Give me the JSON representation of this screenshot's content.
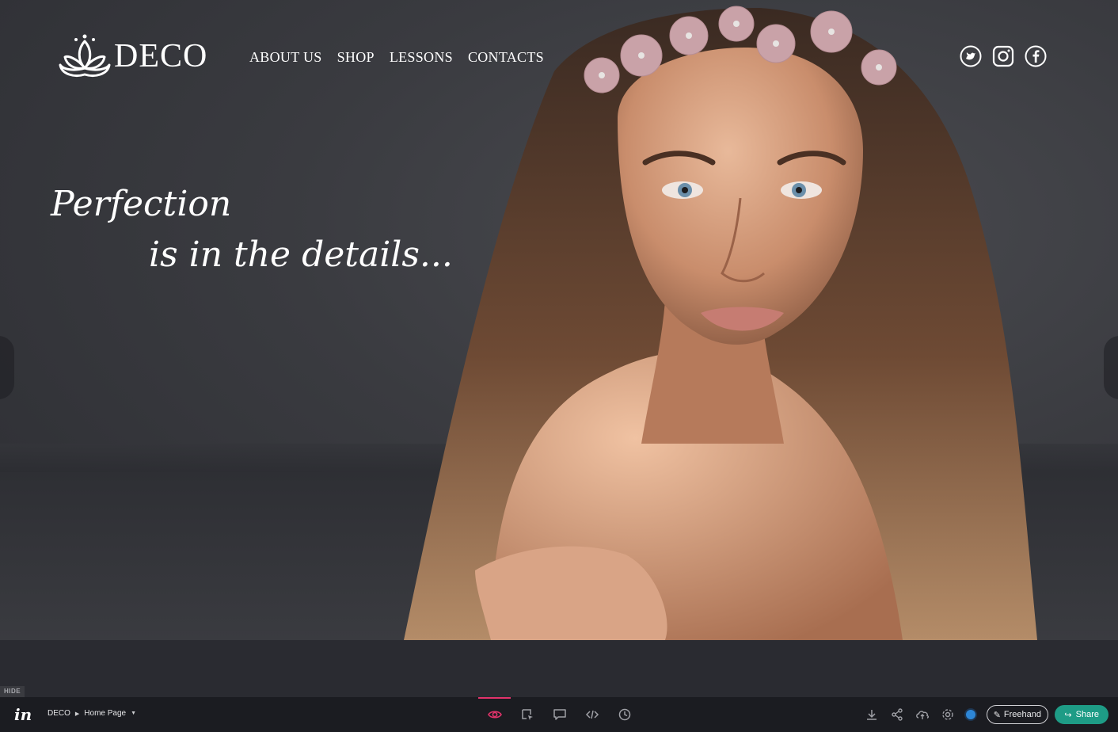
{
  "brand": {
    "name": "DECO"
  },
  "nav": {
    "items": [
      "ABOUT US",
      "SHOP",
      "LESSONS",
      "CONTACTS"
    ]
  },
  "social": {
    "icons": [
      "twitter-icon",
      "instagram-icon",
      "facebook-icon"
    ]
  },
  "hero": {
    "line1": "Perfection",
    "line2": "is in the details..."
  },
  "prototype_bar": {
    "hide_label": "HIDE",
    "logo": "in",
    "project": "DECO",
    "screen": "Home Page",
    "tools": [
      "preview-eye-icon",
      "inspect-icon",
      "comment-icon",
      "code-icon",
      "history-icon"
    ],
    "right_icons": [
      "download-icon",
      "share-nodes-icon",
      "cloud-sync-icon",
      "settings-icon"
    ],
    "freehand_label": "Freehand",
    "share_label": "Share"
  },
  "colors": {
    "accent": "#e2336b",
    "share": "#1e9c86",
    "status_dot": "#2d86d6",
    "background": "#26272d"
  }
}
